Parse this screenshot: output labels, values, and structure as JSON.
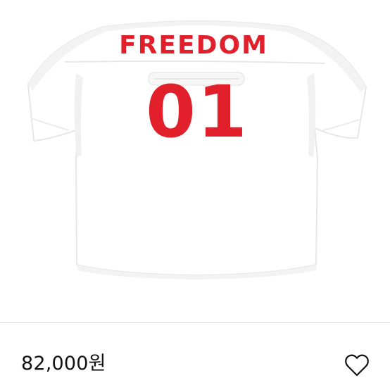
{
  "product": {
    "image": {
      "name_text": "FREEDOM",
      "number_text": "01",
      "text_color": "#e1202c",
      "shirt_color": "#ffffff"
    },
    "price": "82,000원"
  },
  "icons": {
    "wishlist": "heart-outline-icon"
  },
  "colors": {
    "text": "#111111",
    "divider": "#d9d9d9",
    "accent": "#e1202c"
  }
}
